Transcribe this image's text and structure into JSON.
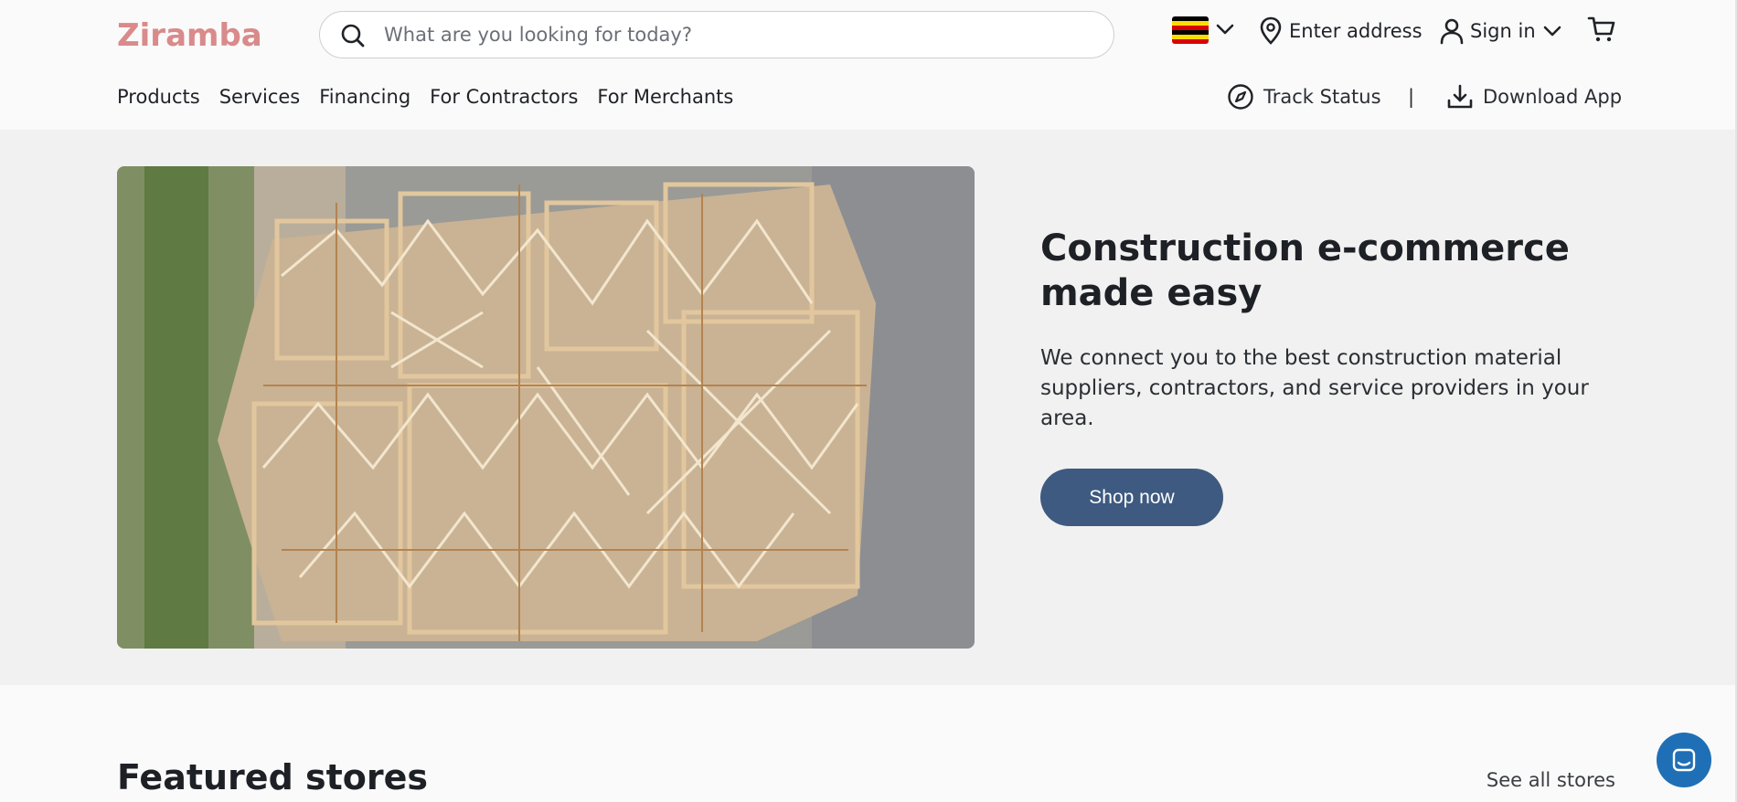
{
  "brand": {
    "name": "Ziramba"
  },
  "search": {
    "placeholder": "What are you looking for today?"
  },
  "country": {
    "flag": "uganda-flag",
    "colors": [
      "#000000",
      "#fcdc04",
      "#d90000"
    ]
  },
  "header_actions": {
    "address_label": "Enter address",
    "signin_label": "Sign in"
  },
  "main_nav": {
    "items": [
      {
        "label": "Products"
      },
      {
        "label": "Services"
      },
      {
        "label": "Financing"
      },
      {
        "label": "For Contractors"
      },
      {
        "label": "For Merchants"
      }
    ]
  },
  "aux_nav": {
    "track_label": "Track Status",
    "separator": "|",
    "download_label": "Download App"
  },
  "hero": {
    "title": "Construction e-commerce made easy",
    "description": "We connect you to the best construction material suppliers, contractors, and service providers in your area.",
    "cta_label": "Shop now"
  },
  "featured": {
    "title": "Featured stores",
    "see_all_label": "See all stores"
  },
  "colors": {
    "brand": "#d98a8a",
    "cta": "#3e5a80",
    "chat": "#1f6fb6",
    "hero_bg": "#f1f1f1"
  },
  "icons": [
    "search-icon",
    "chevron-down-icon",
    "location-pin-icon",
    "user-icon",
    "cart-icon",
    "compass-icon",
    "download-icon",
    "chat-icon"
  ]
}
